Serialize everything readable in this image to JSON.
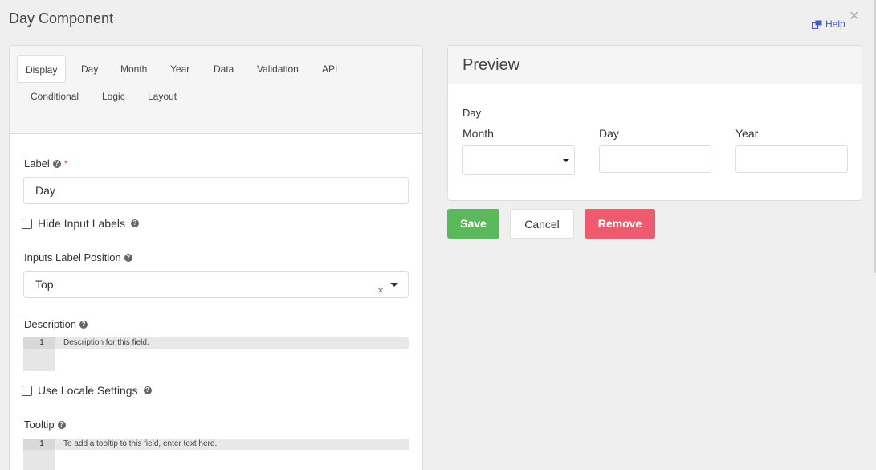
{
  "modal": {
    "title": "Day Component",
    "help": "Help",
    "close": "×"
  },
  "tabs": [
    "Display",
    "Day",
    "Month",
    "Year",
    "Data",
    "Validation",
    "API",
    "Conditional",
    "Logic",
    "Layout"
  ],
  "form": {
    "label_field": {
      "label": "Label",
      "required_mark": "*",
      "value": "Day"
    },
    "hide_input_labels": {
      "label": "Hide Input Labels"
    },
    "inputs_label_position": {
      "label": "Inputs Label Position",
      "value": "Top",
      "clear": "×"
    },
    "description": {
      "label": "Description",
      "line": "1",
      "placeholder": "Description for this field."
    },
    "use_locale": {
      "label": "Use Locale Settings"
    },
    "tooltip": {
      "label": "Tooltip",
      "line": "1",
      "placeholder": "To add a tooltip to this field, enter text here."
    }
  },
  "preview": {
    "title": "Preview",
    "component_label": "Day",
    "month_label": "Month",
    "day_label": "Day",
    "year_label": "Year"
  },
  "buttons": {
    "save": "Save",
    "cancel": "Cancel",
    "remove": "Remove"
  },
  "colors": {
    "save": "#5cb85c",
    "remove": "#f05a6f",
    "help": "#3d5fc4"
  }
}
